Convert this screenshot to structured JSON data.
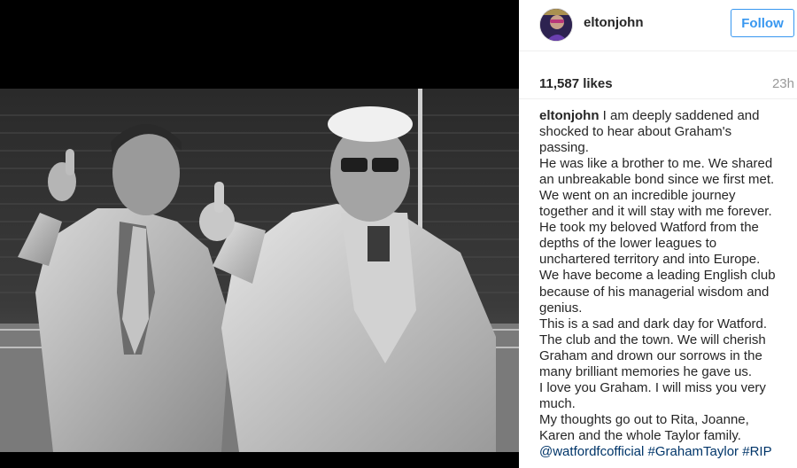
{
  "post": {
    "username": "eltonjohn",
    "follow_label": "Follow",
    "likes": "11,587 likes",
    "time_ago": "23h",
    "caption_user": "eltonjohn",
    "caption_first": "I am deeply saddened and",
    "caption_lines": [
      "shocked to hear about Graham's",
      "passing.",
      "He was like a brother to me. We shared",
      "an unbreakable bond since we first met.",
      "We went on an incredible journey",
      "together and it will stay with me forever.",
      "He took my beloved Watford from the",
      "depths of the lower leagues to",
      "unchartered territory and into Europe.",
      "We have become a leading English club",
      "because of his managerial wisdom and",
      "genius.",
      "This is a sad and dark day for Watford.",
      "The club and the town. We will cherish",
      "Graham and drown our sorrows in the",
      "many brilliant memories he gave us.",
      "I love you Graham. I will miss you very",
      "much.",
      "My thoughts go out to Rita, Joanne,",
      "Karen and the whole Taylor family."
    ],
    "tags": [
      "@watfordfcofficial",
      "#GrahamTaylor",
      "#RIP"
    ]
  },
  "icons": {
    "avatar": "profile-avatar-icon"
  },
  "colors": {
    "accent": "#3897f0",
    "hashtag": "#003569",
    "muted": "#999999",
    "text": "#262626"
  }
}
